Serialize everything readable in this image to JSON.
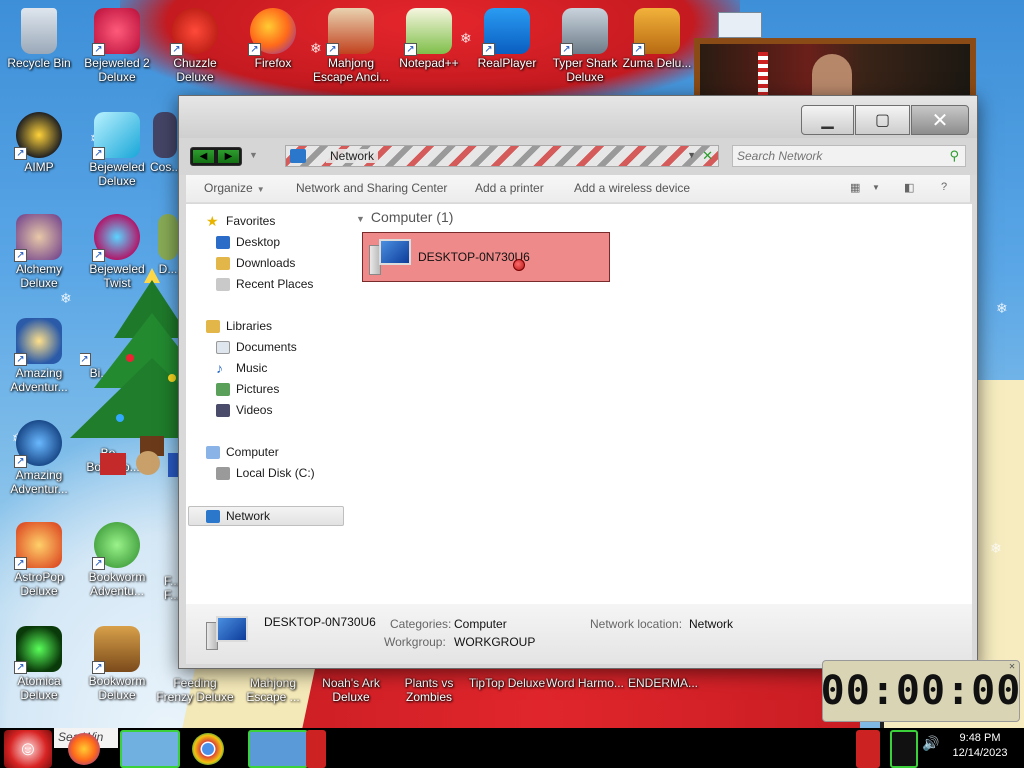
{
  "desktop": {
    "icons": [
      {
        "label": "Recycle Bin"
      },
      {
        "label": "Bejeweled 2 Deluxe"
      },
      {
        "label": "Chuzzle Deluxe"
      },
      {
        "label": "Firefox"
      },
      {
        "label": "Mahjong Escape Anci..."
      },
      {
        "label": "Notepad++"
      },
      {
        "label": "RealPlayer"
      },
      {
        "label": "Typer Shark Deluxe"
      },
      {
        "label": "Zuma Delu..."
      },
      {
        "label": "AIMP"
      },
      {
        "label": "Bejeweled Deluxe"
      },
      {
        "label": "Cos..."
      },
      {
        "label": "Alchemy Deluxe"
      },
      {
        "label": "Bejeweled Twist"
      },
      {
        "label": "D..."
      },
      {
        "label": "Amazing Adventur..."
      },
      {
        "label": "Bi..."
      },
      {
        "label": "Amazing Adventur..."
      },
      {
        "label": "Bo... Booksto..."
      },
      {
        "label": "AstroPop Deluxe"
      },
      {
        "label": "Bookworm Adventu..."
      },
      {
        "label": "F... F..."
      },
      {
        "label": "Atomica Deluxe"
      },
      {
        "label": "Bookworm Deluxe"
      },
      {
        "label": "Feeding Frenzy Deluxe"
      },
      {
        "label": "Mahjong Escape ..."
      },
      {
        "label": "Noah's Ark Deluxe"
      },
      {
        "label": "Plants vs Zombies"
      },
      {
        "label": "TipTop Deluxe"
      },
      {
        "label": "Word Harmo..."
      },
      {
        "label": "ENDERMA..."
      }
    ]
  },
  "window": {
    "address": {
      "location": "Network"
    },
    "search": {
      "placeholder": "Search Network"
    },
    "toolbar": {
      "organize": "Organize",
      "network_sharing": "Network and Sharing Center",
      "add_printer": "Add a printer",
      "add_wireless": "Add a wireless device"
    },
    "nav": {
      "favorites": "Favorites",
      "desktop": "Desktop",
      "downloads": "Downloads",
      "recent_places": "Recent Places",
      "libraries": "Libraries",
      "documents": "Documents",
      "music": "Music",
      "pictures": "Pictures",
      "videos": "Videos",
      "computer": "Computer",
      "local_disk": "Local Disk (C:)",
      "network": "Network"
    },
    "content": {
      "group_header": "Computer (1)",
      "item_name": "DESKTOP-0N730U6"
    },
    "details": {
      "name": "DESKTOP-0N730U6",
      "categories_label": "Categories:",
      "categories_value": "Computer",
      "workgroup_label": "Workgroup:",
      "workgroup_value": "WORKGROUP",
      "location_label": "Network location:",
      "location_value": "Network"
    }
  },
  "taskbar": {
    "search_text": "Sea",
    "search_text_2": "Win",
    "time": "9:48 PM",
    "date": "12/14/2023"
  },
  "timer_widget": {
    "display": "00:00:00"
  }
}
